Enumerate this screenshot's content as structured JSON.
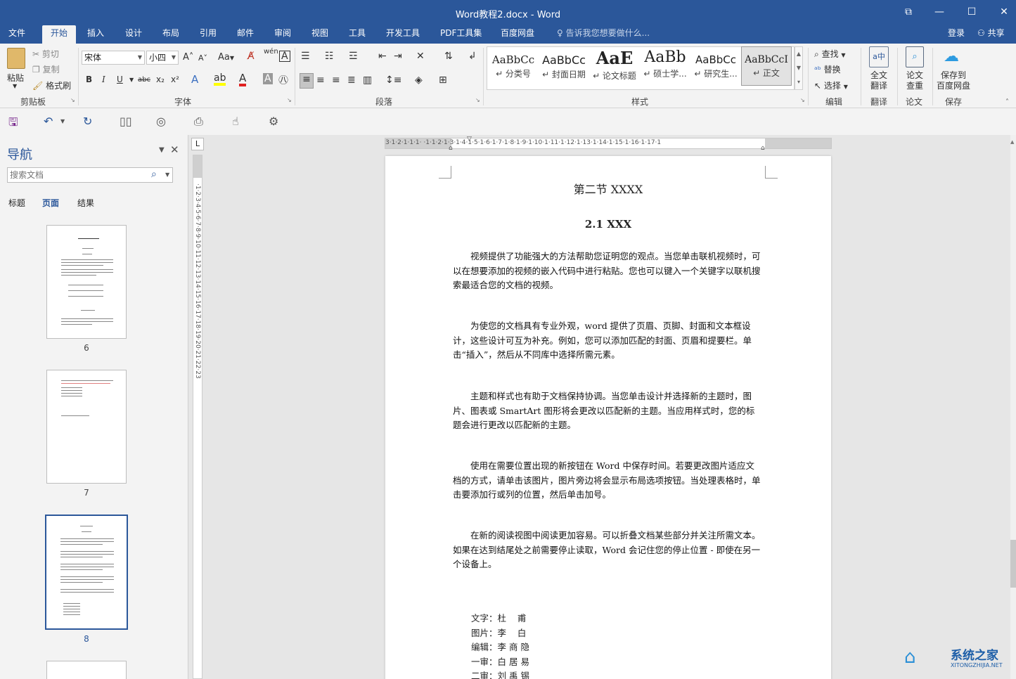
{
  "window": {
    "title": "Word教程2.docx - Word",
    "restore_icon": "restore-icon",
    "minimize_icon": "minimize-icon",
    "maximize_icon": "maximize-icon",
    "close_icon": "close-icon"
  },
  "tabs": [
    "文件",
    "开始",
    "插入",
    "设计",
    "布局",
    "引用",
    "邮件",
    "审阅",
    "视图",
    "工具",
    "开发工具",
    "PDF工具集",
    "百度网盘"
  ],
  "active_tab": "开始",
  "tell_me": "告诉我您想要做什么...",
  "login": "登录",
  "share": "共享",
  "clipboard": {
    "paste": "粘贴",
    "cut": "剪切",
    "copy": "复制",
    "format_painter": "格式刷",
    "label": "剪贴板"
  },
  "font": {
    "name": "宋体",
    "size": "小四",
    "label": "字体",
    "aa": "Aa",
    "wen": "wén",
    "bold": "B",
    "italic": "I",
    "underline": "U",
    "strike": "abc",
    "sub": "x₂",
    "sup": "x²",
    "grow": "A˄",
    "shrink": "A˅",
    "letter_a": "A"
  },
  "paragraph": {
    "label": "段落"
  },
  "styles": {
    "label": "样式",
    "items": [
      {
        "preview": "AaBbCc",
        "name": "↵ 分类号"
      },
      {
        "preview": "AaBbCc",
        "name": "↵ 封面日期"
      },
      {
        "preview": "AaE",
        "name": "↵ 论文标题"
      },
      {
        "preview": "AaBb",
        "name": "↵ 硕士学..."
      },
      {
        "preview": "AaBbCc",
        "name": "↵ 研究生..."
      },
      {
        "preview": "AaBbCcI",
        "name": "↵ 正文"
      }
    ]
  },
  "editing": {
    "find": "查找",
    "replace": "替换",
    "select": "选择",
    "label": "编辑"
  },
  "translate": {
    "btn": "全文\n翻译",
    "btn_l1": "全文",
    "btn_l2": "翻译",
    "label": "翻译"
  },
  "thesis": {
    "btn_l1": "论文",
    "btn_l2": "查重",
    "label": "论文"
  },
  "save_cloud": {
    "btn_l1": "保存到",
    "btn_l2": "百度网盘",
    "label": "保存"
  },
  "nav": {
    "title": "导航",
    "search_placeholder": "搜索文档",
    "tabs": [
      "标题",
      "页面",
      "结果"
    ],
    "active_tab": "页面",
    "thumb_numbers": [
      "6",
      "7",
      "8"
    ]
  },
  "ruler_tab": "L",
  "hruler_text": "3·1·2·1·1·1· ·1·1·2·1·3·1·4·1·5·1·6·1·7·1·8·1·9·1·10·1·11·1·12·1·13·1·14·1·15·1·16·1·17·1",
  "vruler_text": "·1·2·3·4·5·6·7·8·9·10·11·12·13·14·15·16·17·18·19·20·21·22·23",
  "doc": {
    "heading": "第二节  XXXX",
    "subheading": "2.1 XXX",
    "paragraphs": [
      "视频提供了功能强大的方法帮助您证明您的观点。当您单击联机视频时，可以在想要添加的视频的嵌入代码中进行粘贴。您也可以键入一个关键字以联机搜索最适合您的文档的视频。",
      "为使您的文档具有专业外观，word 提供了页眉、页脚、封面和文本框设计，这些设计可互为补充。例如，您可以添加匹配的封面、页眉和提要栏。单击“插入”，然后从不同库中选择所需元素。",
      "主题和样式也有助于文档保持协调。当您单击设计并选择新的主题时，图片、图表或 SmartArt 图形将会更改以匹配新的主题。当应用样式时，您的标题会进行更改以匹配新的主题。",
      "使用在需要位置出现的新按钮在 Word 中保存时间。若要更改图片适应文档的方式，请单击该图片，图片旁边将会显示布局选项按钮。当处理表格时，单击要添加行或列的位置，然后单击加号。",
      "在新的阅读视图中阅读更加容易。可以折叠文档某些部分并关注所需文本。如果在达到结尾处之前需要停止读取，Word 会记住您的停止位置 - 即使在另一个设备上。"
    ],
    "credits": [
      {
        "role": "文字：",
        "name": "杜    甫"
      },
      {
        "role": "图片：",
        "name": "李    白"
      },
      {
        "role": "编辑：",
        "name": "李 商 隐"
      },
      {
        "role": "一审：",
        "name": "白 居 易"
      },
      {
        "role": "二审：",
        "name": "刘 禹 锡"
      }
    ]
  },
  "watermark": {
    "text": "系统之家",
    "sub": "XITONGZHIJIA.NET"
  }
}
